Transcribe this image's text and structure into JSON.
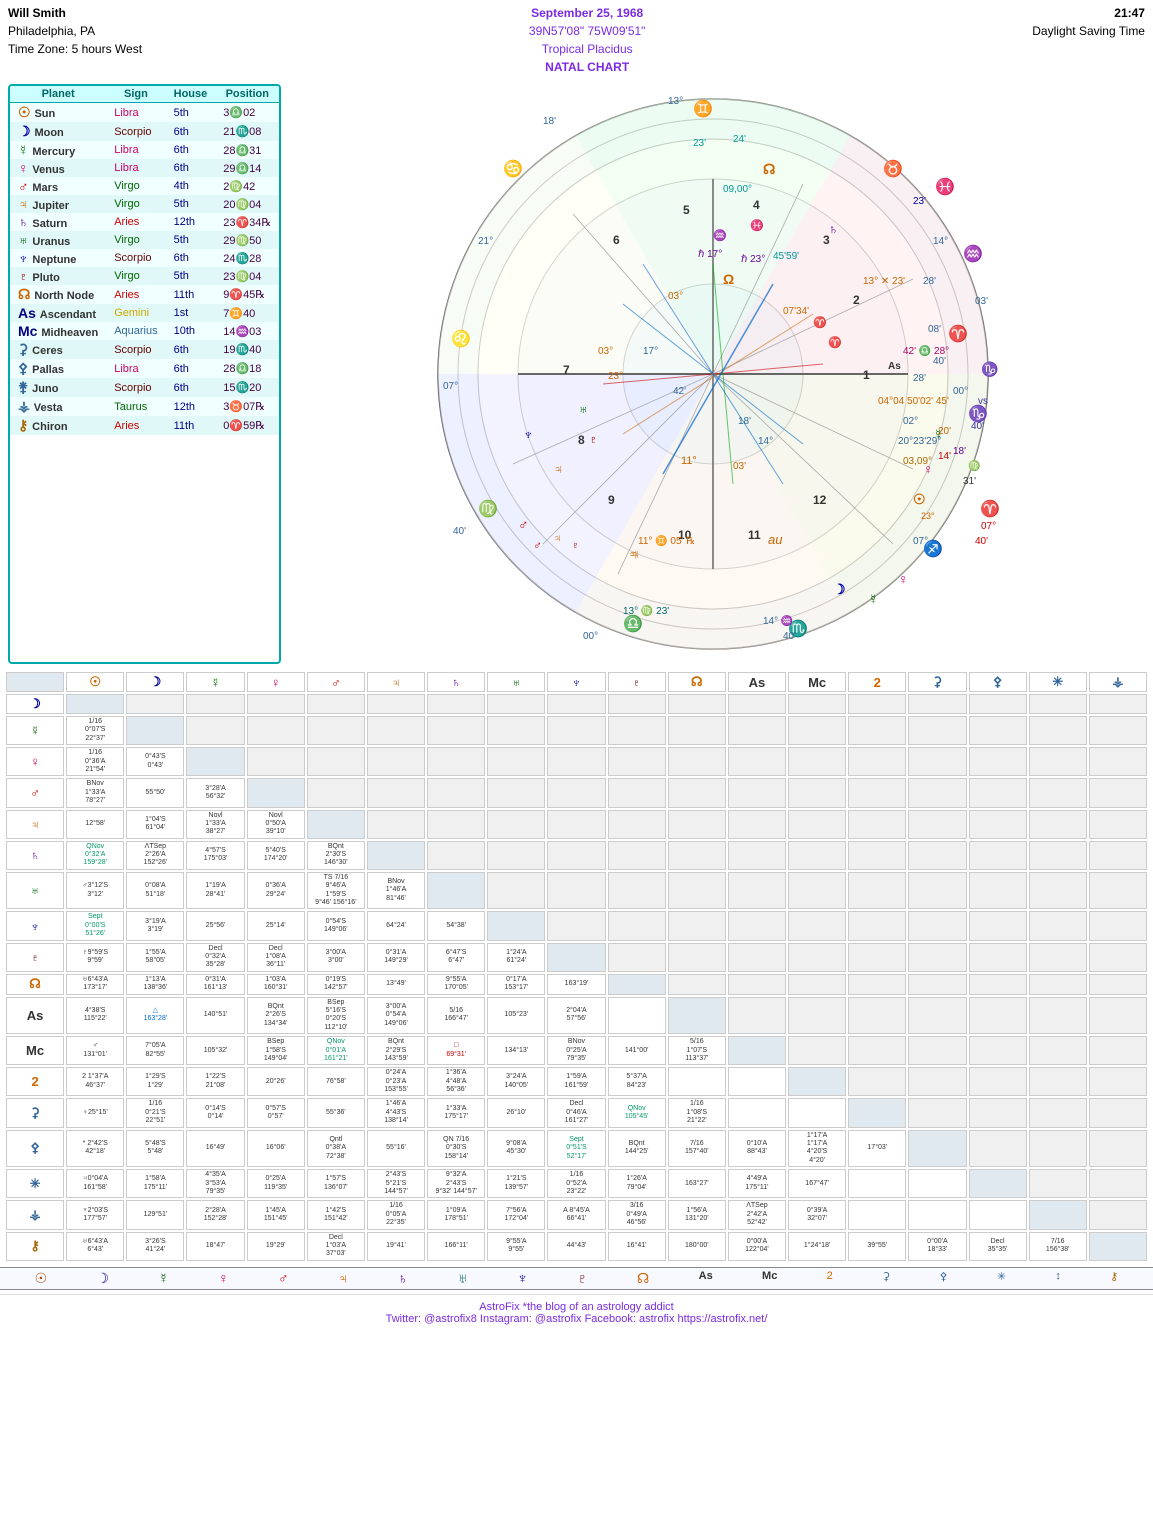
{
  "header": {
    "name": "Will Smith",
    "location": "Philadelphia, PA",
    "timezone": "Time Zone: 5 hours West",
    "date": "September 25, 1968",
    "coords": "39N57'08\"  75W09'51\"",
    "system": "Tropical Placidus",
    "chart_type": "NATAL CHART",
    "time": "21:47",
    "dst": "Daylight Saving Time"
  },
  "planets": [
    {
      "symbol": "☉",
      "name": "Sun",
      "sign": "Libra",
      "house": "5th",
      "position": "3♎02"
    },
    {
      "symbol": "☽",
      "name": "Moon",
      "sign": "Scorpio",
      "house": "6th",
      "position": "21♏08"
    },
    {
      "symbol": "☿",
      "name": "Mercury",
      "sign": "Libra",
      "house": "6th",
      "position": "28♎31"
    },
    {
      "symbol": "♀",
      "name": "Venus",
      "sign": "Libra",
      "house": "6th",
      "position": "29♎14"
    },
    {
      "symbol": "♂",
      "name": "Mars",
      "sign": "Virgo",
      "house": "4th",
      "position": "2♍42"
    },
    {
      "symbol": "♃",
      "name": "Jupiter",
      "sign": "Virgo",
      "house": "5th",
      "position": "20♍04"
    },
    {
      "symbol": "♄",
      "name": "Saturn",
      "sign": "Aries",
      "house": "12th",
      "position": "23♈34℞"
    },
    {
      "symbol": "♅",
      "name": "Uranus",
      "sign": "Virgo",
      "house": "5th",
      "position": "29♍50"
    },
    {
      "symbol": "♆",
      "name": "Neptune",
      "sign": "Scorpio",
      "house": "6th",
      "position": "24♏28"
    },
    {
      "symbol": "♇",
      "name": "Pluto",
      "sign": "Virgo",
      "house": "5th",
      "position": "23♍04"
    },
    {
      "symbol": "☊",
      "name": "North Node",
      "sign": "Aries",
      "house": "11th",
      "position": "9♈45℞"
    },
    {
      "symbol": "As",
      "name": "Ascendant",
      "sign": "Gemini",
      "house": "1st",
      "position": "7♊40"
    },
    {
      "symbol": "Mc",
      "name": "Midheaven",
      "sign": "Aquarius",
      "house": "10th",
      "position": "14♒03"
    },
    {
      "symbol": "⚳",
      "name": "Ceres",
      "sign": "Scorpio",
      "house": "6th",
      "position": "19♏40"
    },
    {
      "symbol": "⚴",
      "name": "Pallas",
      "sign": "Libra",
      "house": "6th",
      "position": "28♎18"
    },
    {
      "symbol": "⚵",
      "name": "Juno",
      "sign": "Scorpio",
      "house": "6th",
      "position": "15♏20"
    },
    {
      "symbol": "⚶",
      "name": "Vesta",
      "sign": "Taurus",
      "house": "12th",
      "position": "3♉07℞"
    },
    {
      "symbol": "⚷",
      "name": "Chiron",
      "sign": "Aries",
      "house": "11th",
      "position": "0♈59℞"
    }
  ],
  "footer": {
    "line1": "AstroFix *the blog of an astrology addict",
    "line2": "Twitter: @astrofix8   Instagram: @astrofix   Facebook: astrofix   https://astrofix.net/"
  }
}
